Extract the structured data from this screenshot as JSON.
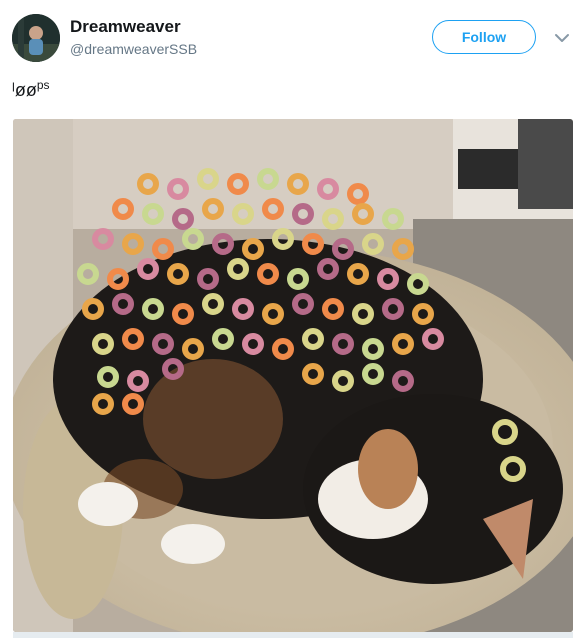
{
  "user": {
    "display_name": "Dreamweaver",
    "handle": "@dreamweaverSSB"
  },
  "actions": {
    "follow_label": "Follow"
  },
  "tweet": {
    "text_main": "ˡøø",
    "text_sup": "ps"
  },
  "icons": {
    "menu": "chevron-down-icon"
  },
  "colors": {
    "accent": "#1da1f2",
    "text": "#14171a",
    "muted": "#657786"
  }
}
